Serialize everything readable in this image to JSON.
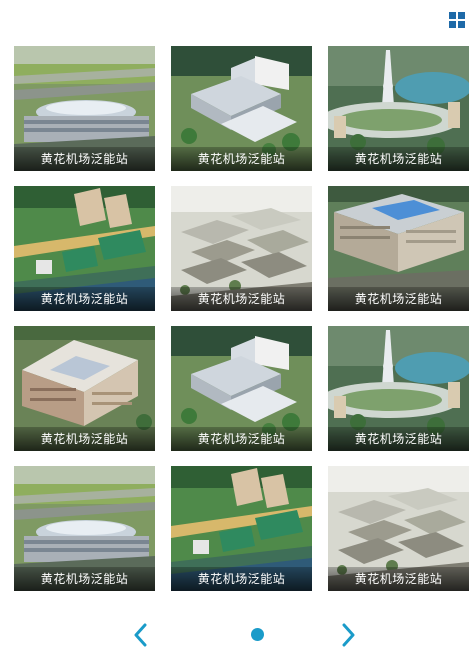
{
  "header": {
    "view_toggle_icon": "grid-icon"
  },
  "gallery": {
    "items": [
      {
        "caption": "黄花机场泛能站",
        "scene": "airport"
      },
      {
        "caption": "黄花机场泛能站",
        "scene": "campus"
      },
      {
        "caption": "黄花机场泛能站",
        "scene": "tower"
      },
      {
        "caption": "黄花机场泛能站",
        "scene": "industrial"
      },
      {
        "caption": "黄花机场泛能站",
        "scene": "township"
      },
      {
        "caption": "黄花机场泛能站",
        "scene": "complex"
      },
      {
        "caption": "黄花机场泛能站",
        "scene": "hotel"
      },
      {
        "caption": "黄花机场泛能站",
        "scene": "campus"
      },
      {
        "caption": "黄花机场泛能站",
        "scene": "tower"
      },
      {
        "caption": "黄花机场泛能站",
        "scene": "airport"
      },
      {
        "caption": "黄花机场泛能站",
        "scene": "industrial"
      },
      {
        "caption": "黄花机场泛能站",
        "scene": "township"
      }
    ]
  },
  "pager": {
    "prev_icon": "chevron-left-icon",
    "next_icon": "chevron-right-icon",
    "pages": 1,
    "current": 1
  },
  "colors": {
    "accent": "#1a9bc9",
    "icon": "#1e6aa8"
  }
}
